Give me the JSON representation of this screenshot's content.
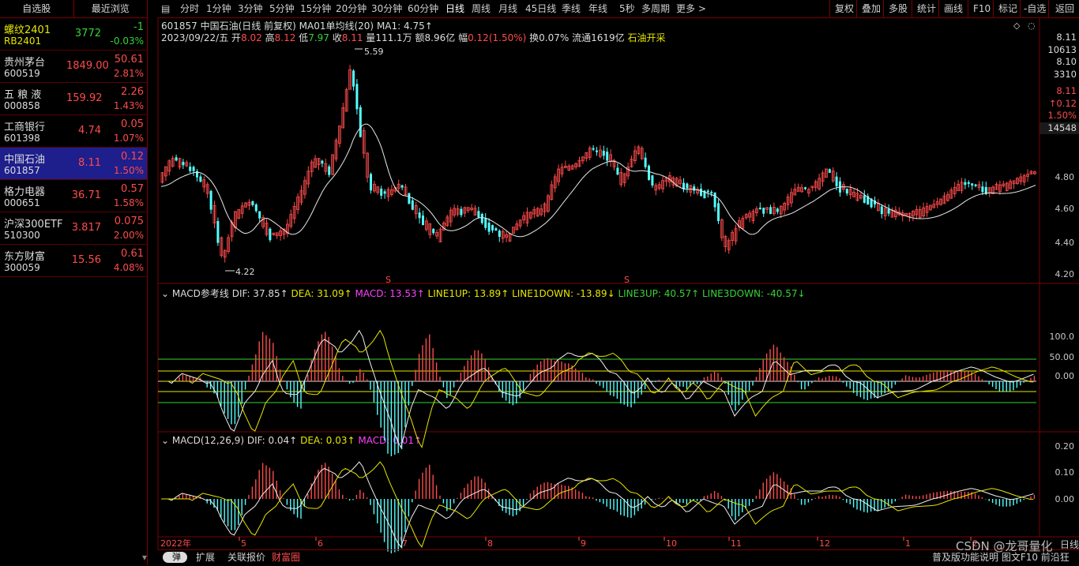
{
  "watchlist": {
    "tab_self": "自选股",
    "tab_recent": "最近浏览",
    "items": [
      {
        "name": "螺纹2401",
        "code": "RB2401",
        "price": "3772",
        "change": "-1",
        "pct": "-0.03%",
        "dir": "down"
      },
      {
        "name": "贵州茅台",
        "code": "600519",
        "price": "1849.00",
        "change": "50.61",
        "pct": "2.81%",
        "dir": "up"
      },
      {
        "name": "五 粮 液",
        "code": "000858",
        "price": "159.92",
        "change": "2.26",
        "pct": "1.43%",
        "dir": "up"
      },
      {
        "name": "工商银行",
        "code": "601398",
        "price": "4.74",
        "change": "0.05",
        "pct": "1.07%",
        "dir": "up"
      },
      {
        "name": "中国石油",
        "code": "601857",
        "price": "8.11",
        "change": "0.12",
        "pct": "1.50%",
        "dir": "up"
      },
      {
        "name": "格力电器",
        "code": "000651",
        "price": "36.71",
        "change": "0.57",
        "pct": "1.58%",
        "dir": "up"
      },
      {
        "name": "沪深300ETF",
        "code": "510300",
        "price": "3.817",
        "change": "0.075",
        "pct": "2.00%",
        "dir": "up"
      },
      {
        "name": "东方财富",
        "code": "300059",
        "price": "15.56",
        "change": "0.61",
        "pct": "4.08%",
        "dir": "up"
      }
    ]
  },
  "toolbar": {
    "periods": [
      "分时",
      "1分钟",
      "3分钟",
      "5分钟",
      "15分钟",
      "20分钟",
      "30分钟",
      "60分钟",
      "日线",
      "周线",
      "月线",
      "45日线",
      "季线",
      "年线",
      "5秒",
      "多周期",
      "更多 >"
    ],
    "active_period": "日线",
    "right": [
      "复权",
      "叠加",
      "多股",
      "统计",
      "画线",
      "F10",
      "标记",
      "-自选",
      "返回"
    ]
  },
  "header": {
    "title": "601857 中国石油(日线 前复权)",
    "ma_label": "MA01单均线(20)",
    "ma_value": "MA1: 4.75↑",
    "date": "2023/09/22/五",
    "open_l": "开",
    "open": "8.02",
    "high_l": "高",
    "high": "8.12",
    "low_l": "低",
    "low": "7.97",
    "close_l": "收",
    "close": "8.11",
    "vol_l": "量",
    "vol": "111.1万",
    "amt_l": "额",
    "amt": "8.96亿",
    "amp_l": "幅",
    "amp": "0.12(1.50%)",
    "turn": "换0.07%",
    "float": "流通1619亿",
    "sector": "石油开采"
  },
  "right_panel": {
    "v1": "8.11",
    "v2": "10613",
    "v3": "8.10",
    "v4": "3310",
    "v5": "8.11",
    "v6": "↑0.12",
    "v7": "1.50%",
    "v8": "14548"
  },
  "price_axis": [
    "4.80",
    "4.60",
    "4.40",
    "4.20"
  ],
  "annotations": {
    "high": "5.59",
    "low": "4.22",
    "s1": "S",
    "s2": "S"
  },
  "macd_ref": {
    "title": "MACD参考线",
    "dif": "DIF: 37.85↑",
    "dea": "DEA: 31.09↑",
    "macd": "MACD: 13.53↑",
    "line1up": "LINE1UP: 13.89↑",
    "line1down": "LINE1DOWN: -13.89↓",
    "line3up": "LINE3UP: 40.57↑",
    "line3down": "LINE3DOWN: -40.57↓",
    "axis": [
      "100.0",
      "50.00",
      "0.00"
    ]
  },
  "macd": {
    "title": "MACD(12,26,9)",
    "dif": "DIF: 0.04↑",
    "dea": "DEA: 0.03↑",
    "macd": "MACD: 0.01↑",
    "axis": [
      "0.20",
      "0.10",
      "0.00"
    ]
  },
  "date_axis": [
    "2022年",
    "5",
    "6",
    "7",
    "8",
    "9",
    "10",
    "11",
    "12",
    "1",
    "2",
    "3"
  ],
  "bottom": {
    "toggle": "弹",
    "tabs": [
      "扩展",
      "关联报价",
      "财富圈"
    ],
    "right_text": "普及版功能说明 图文F10 前沿狂",
    "right_label": "日线",
    "watermark": "CSDN @龙哥量化"
  },
  "colors": {
    "up": "#ff4b4b",
    "down": "#35d335",
    "cyan": "#54ffff",
    "grid": "#7a0000",
    "magenta": "#ff40ff",
    "yellow": "#e6e600"
  }
}
